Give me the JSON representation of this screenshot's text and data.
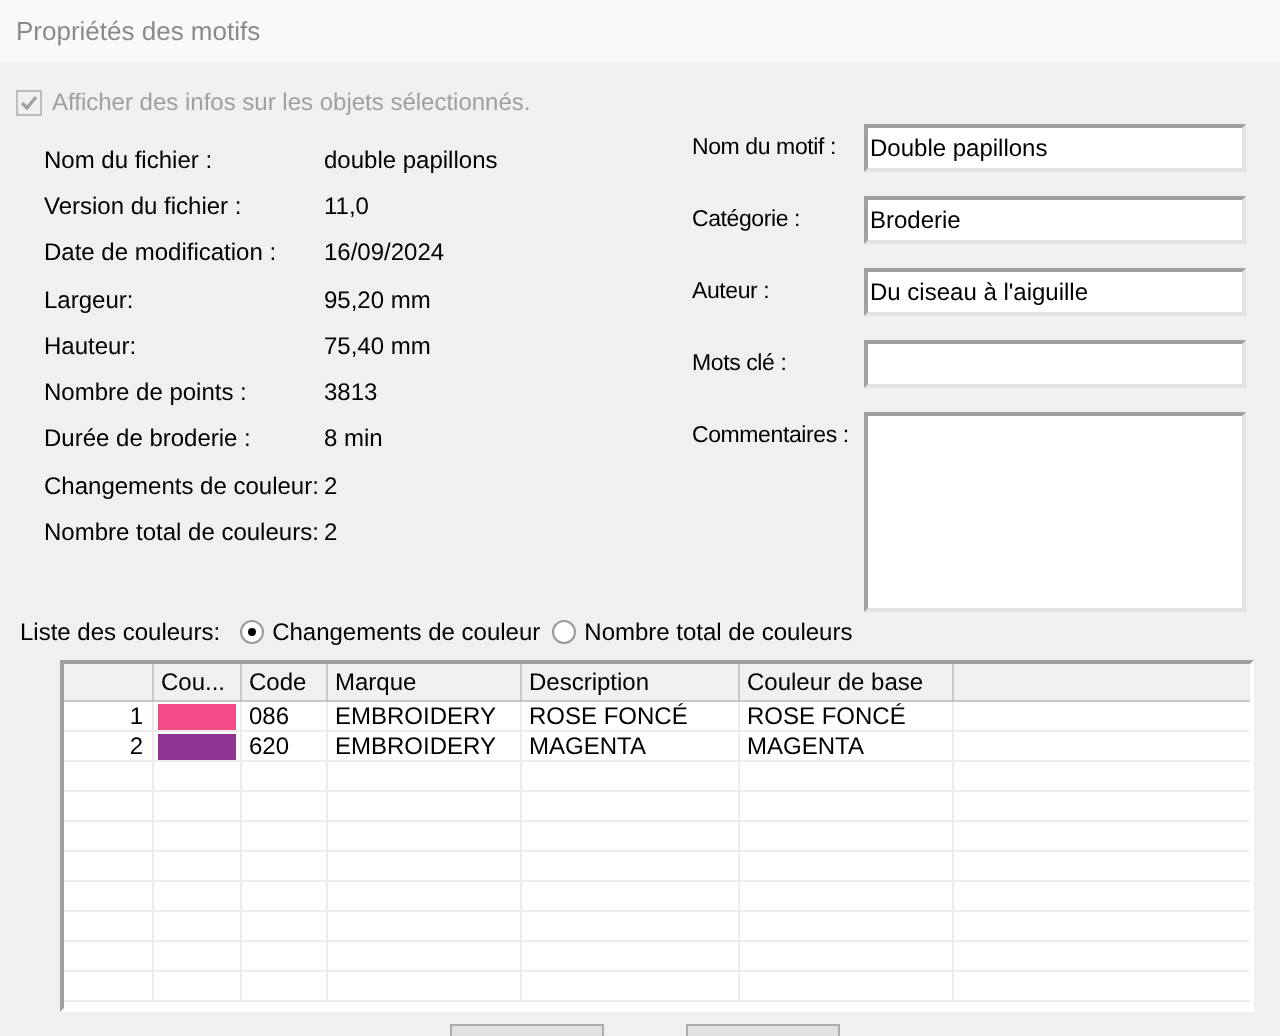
{
  "window": {
    "title": "Propriétés des motifs"
  },
  "show_info": {
    "label": "Afficher des infos sur les objets sélectionnés.",
    "checked": true,
    "disabled": true
  },
  "info": [
    {
      "label": "Nom du fichier :",
      "value": "double papillons"
    },
    {
      "label": "Version du fichier :",
      "value": "11,0"
    },
    {
      "label": "Date de modification :",
      "value": "16/09/2024"
    },
    {
      "label": "Largeur:",
      "value": "95,20 mm"
    },
    {
      "label": "Hauteur:",
      "value": "75,40 mm"
    },
    {
      "label": "Nombre de points :",
      "value": "3813"
    },
    {
      "label": "Durée de broderie :",
      "value": "8 min"
    },
    {
      "label": "Changements de couleur:",
      "value": "2"
    },
    {
      "label": "Nombre total de couleurs:",
      "value": "2"
    }
  ],
  "fields": [
    {
      "label": "Nom du motif :",
      "value": "Double papillons"
    },
    {
      "label": "Catégorie :",
      "value": "Broderie"
    },
    {
      "label": "Auteur :",
      "value": "Du ciseau à l'aiguille"
    },
    {
      "label": "Mots clé :"
    },
    {
      "label": "Commentaires :",
      "kind": "multiline"
    }
  ],
  "color_list": {
    "label": "Liste des couleurs:",
    "options": [
      {
        "label": "Changements de couleur",
        "selected": true
      },
      {
        "label": "Nombre total de couleurs",
        "selected": false
      }
    ]
  },
  "table": {
    "columns": [
      "Cou...",
      "Code",
      "Marque",
      "Description",
      "Couleur de base"
    ],
    "rows": [
      {
        "index": "1",
        "color": "#f44a8a",
        "code": "086",
        "brand": "EMBROIDERY",
        "description": "ROSE FONCÉ",
        "base_color": "ROSE FONCÉ"
      },
      {
        "index": "2",
        "color": "#8e3494",
        "code": "620",
        "brand": "EMBROIDERY",
        "description": "MAGENTA",
        "base_color": "MAGENTA"
      }
    ]
  }
}
